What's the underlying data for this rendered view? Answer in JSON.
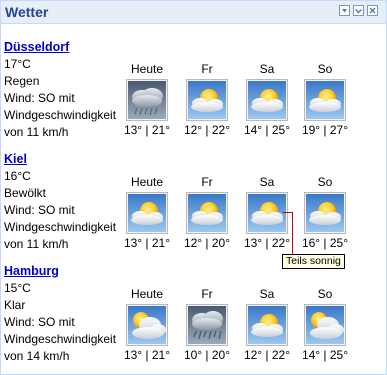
{
  "widget": {
    "title": "Wetter"
  },
  "cities": [
    {
      "name": "Düsseldorf",
      "temp": "17°C",
      "condition": "Regen",
      "wind": "Wind: SO mit",
      "speed_label": "Windgeschwindigkeit",
      "speed": "von 11 km/h",
      "days": [
        {
          "label": "Heute",
          "icon": "rain-icon",
          "temps": "13° | 21°"
        },
        {
          "label": "Fr",
          "icon": "partly-sunny-icon",
          "temps": "12° | 22°"
        },
        {
          "label": "Sa",
          "icon": "partly-sunny-icon",
          "temps": "14° | 25°"
        },
        {
          "label": "So",
          "icon": "partly-sunny-icon",
          "temps": "19° | 27°"
        }
      ]
    },
    {
      "name": "Kiel",
      "temp": "16°C",
      "condition": "Bewölkt",
      "wind": "Wind: SO mit",
      "speed_label": "Windgeschwindigkeit",
      "speed": "von 11 km/h",
      "days": [
        {
          "label": "Heute",
          "icon": "partly-sunny-icon",
          "temps": "13° | 21°"
        },
        {
          "label": "Fr",
          "icon": "partly-sunny-icon",
          "temps": "12° | 20°"
        },
        {
          "label": "Sa",
          "icon": "partly-sunny-icon",
          "temps": "13° | 22°"
        },
        {
          "label": "So",
          "icon": "partly-sunny-icon",
          "temps": "16° | 25°"
        }
      ]
    },
    {
      "name": "Hamburg",
      "temp": "15°C",
      "condition": "Klar",
      "wind": "Wind: SO mit",
      "speed_label": "Windgeschwindigkeit",
      "speed": "von 14 km/h",
      "days": [
        {
          "label": "Heute",
          "icon": "partly-cloudy-icon",
          "temps": "13° | 21°"
        },
        {
          "label": "Fr",
          "icon": "rain-icon",
          "temps": "10° | 20°"
        },
        {
          "label": "Sa",
          "icon": "partly-sunny-icon",
          "temps": "12° | 22°"
        },
        {
          "label": "So",
          "icon": "partly-cloudy-icon",
          "temps": "14° | 25°"
        }
      ]
    }
  ],
  "tooltip": {
    "text": "Teils sonnig"
  }
}
